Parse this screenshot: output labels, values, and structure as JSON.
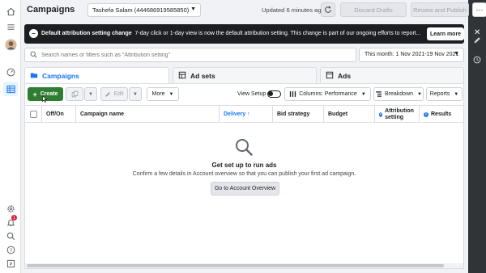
{
  "header": {
    "title": "Campaigns",
    "account": "Tashefa Salam (444686919585850)",
    "updated": "Updated 6 minutes ago",
    "discard_label": "Discard Drafts",
    "review_label": "Review and Publish",
    "more_symbol": "⋯"
  },
  "banner": {
    "bold": "Default attribution setting change",
    "text": "7-day click or 1-day view is now the default attribution setting. This change is part of our ongoing efforts to report...",
    "learn_more": "Learn more",
    "close": "✕"
  },
  "search": {
    "placeholder": "Search names or filters such as \"Attribution setting\""
  },
  "date_range": "This month: 1 Nov 2021-19 Nov 2021",
  "tabs": [
    {
      "label": "Campaigns",
      "active": true
    },
    {
      "label": "Ad sets",
      "active": false
    },
    {
      "label": "Ads",
      "active": false
    }
  ],
  "toolbar": {
    "create": "Create",
    "edit": "Edit",
    "more": "More",
    "view_setup": "View Setup",
    "columns": "Columns: Performance",
    "breakdown": "Breakdown",
    "reports": "Reports"
  },
  "table": {
    "columns": [
      "Off/On",
      "Campaign name",
      "Delivery ↑",
      "Bid strategy",
      "Budget",
      "Attribution setting",
      "Results"
    ]
  },
  "empty_state": {
    "title": "Get set up to run ads",
    "text": "Confirm a few details in Account overview so that you can publish your first ad campaign.",
    "button": "Go to Account Overview"
  },
  "colors": {
    "accent": "#1877f2",
    "create_green": "#2e7d32",
    "banner_bg": "#1c1e21",
    "right_bar": "#303338"
  },
  "icons": {
    "left_nav": [
      "home-icon",
      "menu-icon",
      "avatar",
      "gauge-icon",
      "grid-icon",
      "settings-icon",
      "notifications-icon",
      "search-icon",
      "help-icon",
      "reports-icon"
    ],
    "right_bar": [
      "chart-icon",
      "pencil-icon",
      "clock-icon"
    ]
  },
  "notification_badge": "1"
}
